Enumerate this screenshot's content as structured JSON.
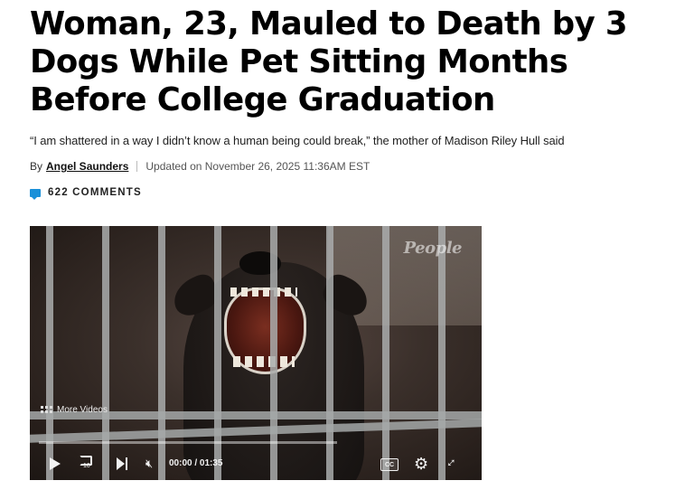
{
  "article": {
    "headline": "Woman, 23, Mauled to Death by 3 Dogs While Pet Sitting Months Before College Graduation",
    "subhead": "“I am shattered in a way I didn’t know a human being could break,” the mother of Madison Riley Hull said",
    "byline_prefix": "By",
    "author": "Angel Saunders",
    "updated": "Updated on November 26, 2025 11:36AM EST",
    "comments_label": "622 COMMENTS"
  },
  "video": {
    "watermark": "People",
    "more_videos_label": "More Videos",
    "rewind_seconds": "10",
    "current_time": "00:00",
    "time_separator": "/",
    "duration": "01:35",
    "cc_label": "CC",
    "progress": 0
  },
  "icons": {
    "comment": "comment-bubble-icon",
    "play": "play-icon",
    "rewind": "rewind-10-icon",
    "next": "skip-next-icon",
    "mute": "mute-icon",
    "settings": "gear-icon",
    "fullscreen": "fullscreen-icon",
    "more_videos": "grid-icon"
  },
  "colors": {
    "comment_accent": "#1a90d9"
  }
}
